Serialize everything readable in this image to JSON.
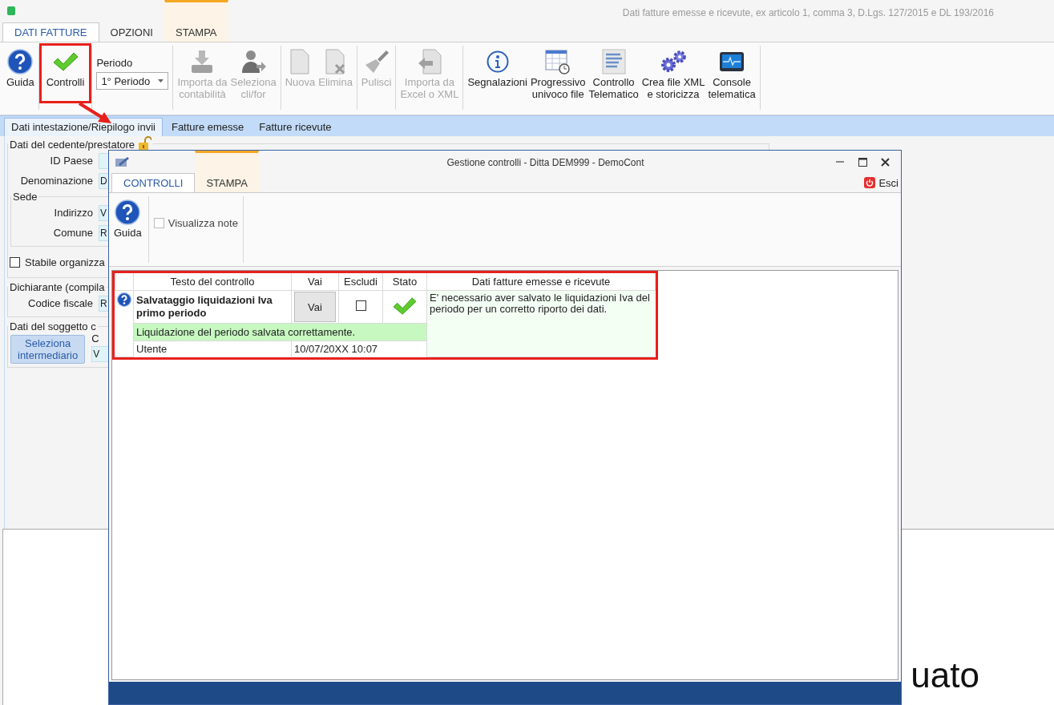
{
  "window": {
    "title": "Dati fatture emesse e ricevute, ex articolo 1, comma 3, D.Lgs. 127/2015 e DL 193/2016"
  },
  "tabs": [
    {
      "label": "DATI FATTURE",
      "selected": true,
      "kind": "normal"
    },
    {
      "label": "OPZIONI",
      "selected": false,
      "kind": "normal"
    },
    {
      "label": "STAMPA",
      "selected": false,
      "kind": "contextual"
    }
  ],
  "ribbon": {
    "groups": [
      {
        "items": [
          {
            "kind": "button",
            "label": "Guida",
            "disabled": false,
            "highlighted": false
          }
        ]
      },
      {
        "items": [
          {
            "kind": "button",
            "label": "Controlli",
            "disabled": false,
            "highlighted": true
          }
        ]
      },
      {
        "items": [
          {
            "kind": "dropdown",
            "label": "Periodo",
            "value": "1° Periodo"
          }
        ]
      },
      {
        "items": [
          {
            "kind": "button",
            "label": "Importa da\ncontabilità",
            "disabled": true,
            "highlighted": false
          },
          {
            "kind": "button",
            "label": "Seleziona\ncli/for",
            "disabled": true,
            "highlighted": false
          }
        ]
      },
      {
        "items": [
          {
            "kind": "button",
            "label": "Nuova",
            "disabled": true,
            "highlighted": false
          },
          {
            "kind": "button",
            "label": "Elimina",
            "disabled": true,
            "highlighted": false
          }
        ]
      },
      {
        "items": [
          {
            "kind": "button",
            "label": "Pulisci",
            "disabled": true,
            "highlighted": false
          }
        ]
      },
      {
        "items": [
          {
            "kind": "button",
            "label": "Importa da\nExcel o XML",
            "disabled": true,
            "highlighted": false
          }
        ]
      },
      {
        "items": [
          {
            "kind": "button",
            "label": "Segnalazioni",
            "disabled": false,
            "highlighted": false
          },
          {
            "kind": "button",
            "label": "Progressivo\nunivoco file",
            "disabled": false,
            "highlighted": false
          },
          {
            "kind": "button",
            "label": "Controllo\nTelematico",
            "disabled": false,
            "highlighted": false
          },
          {
            "kind": "button",
            "label": "Crea file XML\ne storicizza",
            "disabled": false,
            "highlighted": false
          },
          {
            "kind": "button",
            "label": "Console\ntelematica",
            "disabled": false,
            "highlighted": false
          }
        ]
      }
    ]
  },
  "section_tabs": [
    {
      "label": "Dati intestazione/Riepilogo invii",
      "selected": true
    },
    {
      "label": "Fatture emesse",
      "selected": false
    },
    {
      "label": "Fatture ricevute",
      "selected": false
    }
  ],
  "form": [
    {
      "kind": "group",
      "legend": "Dati del cedente/prestatore",
      "locked": false,
      "children": [
        {
          "kind": "field",
          "label": "ID Paese"
        },
        {
          "kind": "field",
          "label": "Denominazione",
          "value": "D"
        },
        {
          "kind": "group",
          "legend": "Sede",
          "children": [
            {
              "kind": "field",
              "label": "Indirizzo",
              "value": "V"
            },
            {
              "kind": "field",
              "label": "Comune",
              "value": "R"
            }
          ]
        },
        {
          "kind": "checkbox",
          "label": "Stabile organizza",
          "checked": false
        }
      ]
    },
    {
      "kind": "group",
      "legend": "Dichiarante (compila",
      "children": [
        {
          "kind": "field",
          "label": "Codice fiscale",
          "value": "R"
        }
      ]
    },
    {
      "kind": "group",
      "legend": "Dati del soggetto c",
      "children": [
        {
          "kind": "button",
          "label": "Seleziona\nintermediario"
        },
        {
          "kind": "stacked-field",
          "label": "C",
          "value": "V"
        }
      ]
    }
  ],
  "bottom_panel": {
    "text": "uato"
  },
  "dialog": {
    "title": "Gestione controlli - Ditta DEM999 - DemoCont",
    "tabs": [
      {
        "label": "CONTROLLI",
        "selected": true,
        "kind": "normal"
      },
      {
        "label": "STAMPA",
        "selected": false,
        "kind": "contextual"
      }
    ],
    "exit_label": "Esci",
    "ribbon": [
      {
        "kind": "button",
        "label": "Guida"
      },
      {
        "kind": "checkbox",
        "label": "Visualizza note",
        "checked": false
      }
    ],
    "table": {
      "highlighted": true,
      "columns": [
        "Testo del controllo",
        "Vai",
        "Escludi",
        "Stato",
        "Dati fatture emesse e ricevute"
      ],
      "rows": [
        {
          "title": "Salvataggio liquidazioni Iva primo periodo",
          "action": "Vai",
          "excluded": false,
          "passed": true,
          "note": "E' necessario aver salvato le liquidazioni Iva del periodo per un corretto riporto dei dati.",
          "message": "Liquidazione del periodo salvata correttamente.",
          "user_label": "Utente",
          "timestamp": "10/07/20XX 10:07"
        }
      ]
    }
  }
}
